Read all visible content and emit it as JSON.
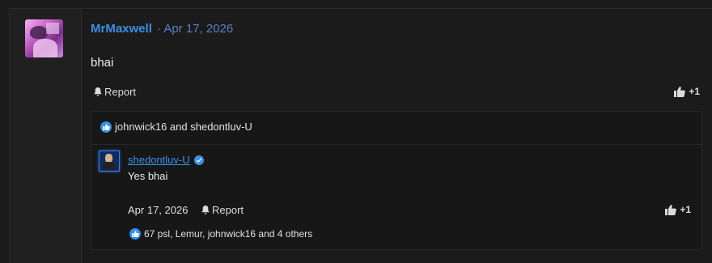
{
  "post": {
    "username": "MrMaxwell",
    "separator_date": "· Apr 17, 2026",
    "body": "bhai",
    "report_label": "Report",
    "plus_label": "+1",
    "reactions_text": "johnwick16 and shedontluv-U"
  },
  "reply": {
    "username": "shedontluv-U",
    "body": "Yes bhai",
    "date": "Apr 17, 2026",
    "report_label": "Report",
    "plus_label": "+1",
    "reactions_text": "67 psl, Lemur, johnwick16 and 4 others"
  },
  "colors": {
    "accent": "#3a8fe6",
    "like_badge": "#2f8fe8",
    "background": "#1c1c1c"
  },
  "icons": [
    "bell-icon",
    "thumbs-up-icon",
    "like-badge-icon",
    "verified-icon"
  ]
}
